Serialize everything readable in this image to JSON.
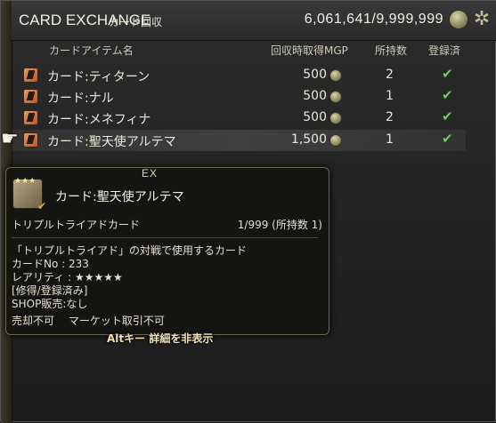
{
  "window": {
    "title": "CARD EXCHANGE",
    "subtitle": "カード回収",
    "mgp_total": "6,061,641/9,999,999"
  },
  "columns": {
    "name": "カードアイテム名",
    "mgp": "回収時取得MGP",
    "owned": "所持数",
    "registered": "登録済"
  },
  "rows": [
    {
      "name": "カード:ティターン",
      "mgp": "500",
      "owned": "2",
      "registered": "✔"
    },
    {
      "name": "カード:ナル",
      "mgp": "500",
      "owned": "1",
      "registered": "✔"
    },
    {
      "name": "カード:メネフィナ",
      "mgp": "500",
      "owned": "2",
      "registered": "✔"
    },
    {
      "name": "カード:聖天使アルテマ",
      "mgp": "1,500",
      "owned": "1",
      "registered": "✔",
      "selected": true
    }
  ],
  "tooltip": {
    "tag": "EX",
    "name": "カード:聖天使アルテマ",
    "type": "トリプルトライアドカード",
    "count": "1/999 (所持数 1)",
    "lines": [
      "「トリプルトライアド」の対戦で使用するカード",
      "カードNo : 233",
      "レアリティ : ★★★★★",
      "[修得/登録済み]",
      "SHOP販売:なし",
      "売却不可　 マーケット取引不可"
    ],
    "footer": "Altキー 詳細を非表示",
    "icon_stars": "★★★"
  },
  "icons": {
    "pointer": "pointing-hand-icon",
    "gear": "gear-icon",
    "coin": "mgp-coin-icon",
    "check": "check-icon"
  },
  "colors": {
    "check": "#6fd067",
    "footer_text": "#f1e3b4"
  }
}
